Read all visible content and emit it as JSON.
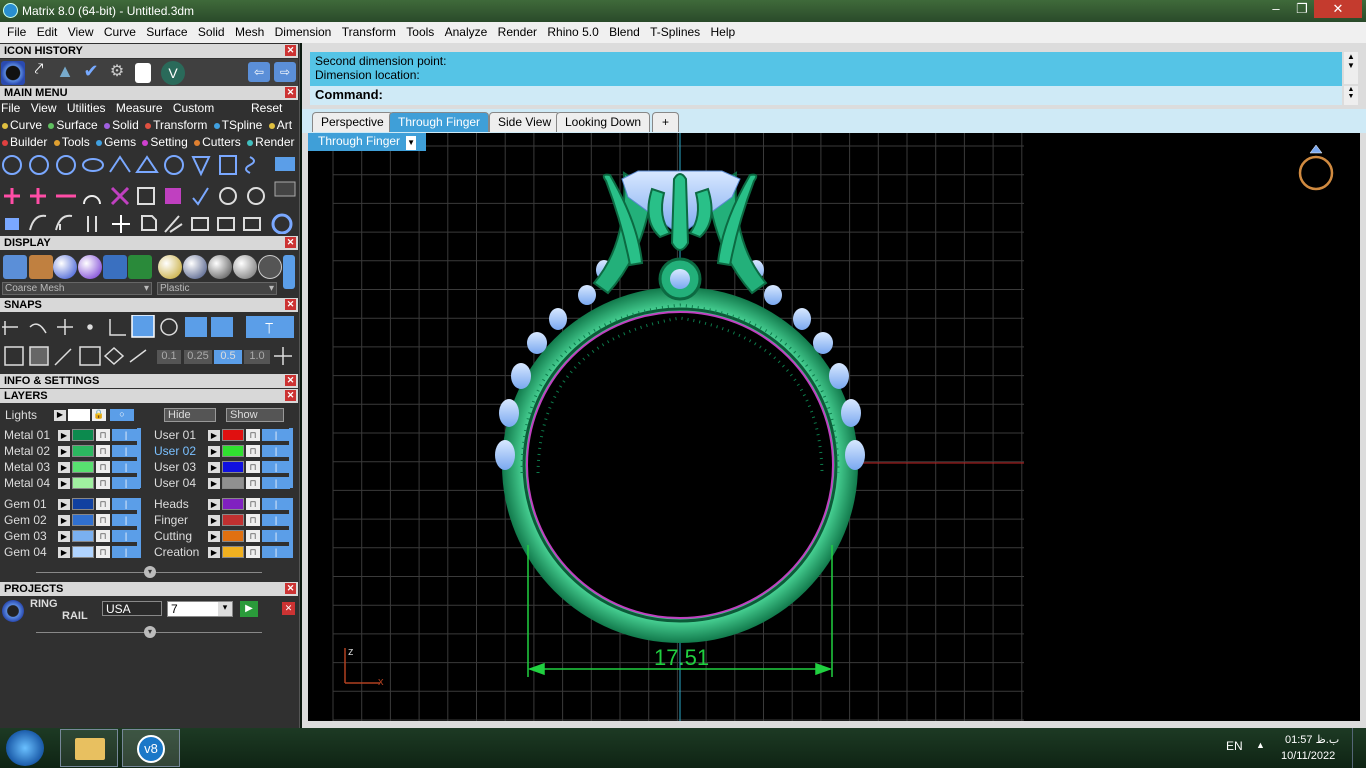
{
  "window": {
    "title": "Matrix 8.0 (64-bit) - Untitled.3dm",
    "controls": [
      "–",
      "❐",
      "✕"
    ]
  },
  "menu": [
    "File",
    "Edit",
    "View",
    "Curve",
    "Surface",
    "Solid",
    "Mesh",
    "Dimension",
    "Transform",
    "Tools",
    "Analyze",
    "Render",
    "Rhino 5.0",
    "Blend",
    "T-Splines",
    "Help"
  ],
  "panels": {
    "icon_history": "ICON HISTORY",
    "main_menu": "MAIN MENU",
    "display": "DISPLAY",
    "snaps": "SNAPS",
    "info_settings": "INFO & SETTINGS",
    "layers": "LAYERS",
    "projects": "PROJECTS"
  },
  "main_menu_bar": [
    "File",
    "View",
    "Utilities",
    "Measure",
    "Custom"
  ],
  "main_menu_reset": "Reset",
  "builder_row1": [
    "Curve",
    "Surface",
    "Solid",
    "Transform",
    "TSpline",
    "Art"
  ],
  "builder_row2": [
    "Builder",
    "Tools",
    "Gems",
    "Setting",
    "Cutters",
    "Render"
  ],
  "builder_colors": {
    "row1": [
      "#e0c040",
      "#60c060",
      "#a060e0",
      "#e05040",
      "#40a0e0",
      "#e0c040"
    ],
    "row2": [
      "#e04040",
      "#e0a030",
      "#40a0e0",
      "#d040d0",
      "#e08030",
      "#40c0c0"
    ]
  },
  "display": {
    "mesh_select": "Coarse Mesh",
    "material_select": "Plastic"
  },
  "snaps_values": [
    "0.1",
    "0.25",
    "0.5",
    "1.0"
  ],
  "lights": {
    "label": "Lights",
    "hide": "Hide",
    "show": "Show"
  },
  "layers_left": [
    {
      "name": "Metal 01",
      "color": "#0c8a4e"
    },
    {
      "name": "Metal 02",
      "color": "#2cb860"
    },
    {
      "name": "Metal 03",
      "color": "#58e070"
    },
    {
      "name": "Metal 04",
      "color": "#a0f0a0"
    },
    {
      "name": "Gem 01",
      "color": "#1040a0"
    },
    {
      "name": "Gem 02",
      "color": "#3070d0"
    },
    {
      "name": "Gem 03",
      "color": "#7ab0f0"
    },
    {
      "name": "Gem 04",
      "color": "#b0d4ff"
    }
  ],
  "layers_right": [
    {
      "name": "User 01",
      "color": "#e01010"
    },
    {
      "name": "User 02",
      "color": "#30e030"
    },
    {
      "name": "User 03",
      "color": "#1010e0"
    },
    {
      "name": "User 04",
      "color": "#909090"
    },
    {
      "name": "Heads",
      "color": "#8020c0"
    },
    {
      "name": "Finger",
      "color": "#c03030"
    },
    {
      "name": "Cutting",
      "color": "#e07010"
    },
    {
      "name": "Creation",
      "color": "#f0b020"
    }
  ],
  "projects": {
    "name_line1": "RING",
    "name_line2": "RAIL",
    "region": "USA",
    "size": "7"
  },
  "command": {
    "line1": "Second dimension point:",
    "line2": "Dimension location:",
    "prompt": "Command:"
  },
  "tabs": [
    "Perspective",
    "Through Finger",
    "Side View",
    "Looking Down",
    "+"
  ],
  "active_tab": "Through Finger",
  "viewport_label": "Through Finger",
  "dimension_value": "17.51",
  "axis_labels": {
    "z": "z",
    "x": "x"
  },
  "taskbar": {
    "lang": "EN",
    "time": "01:57 ب.ظ",
    "date": "10/11/2022",
    "app_label": "v8"
  }
}
